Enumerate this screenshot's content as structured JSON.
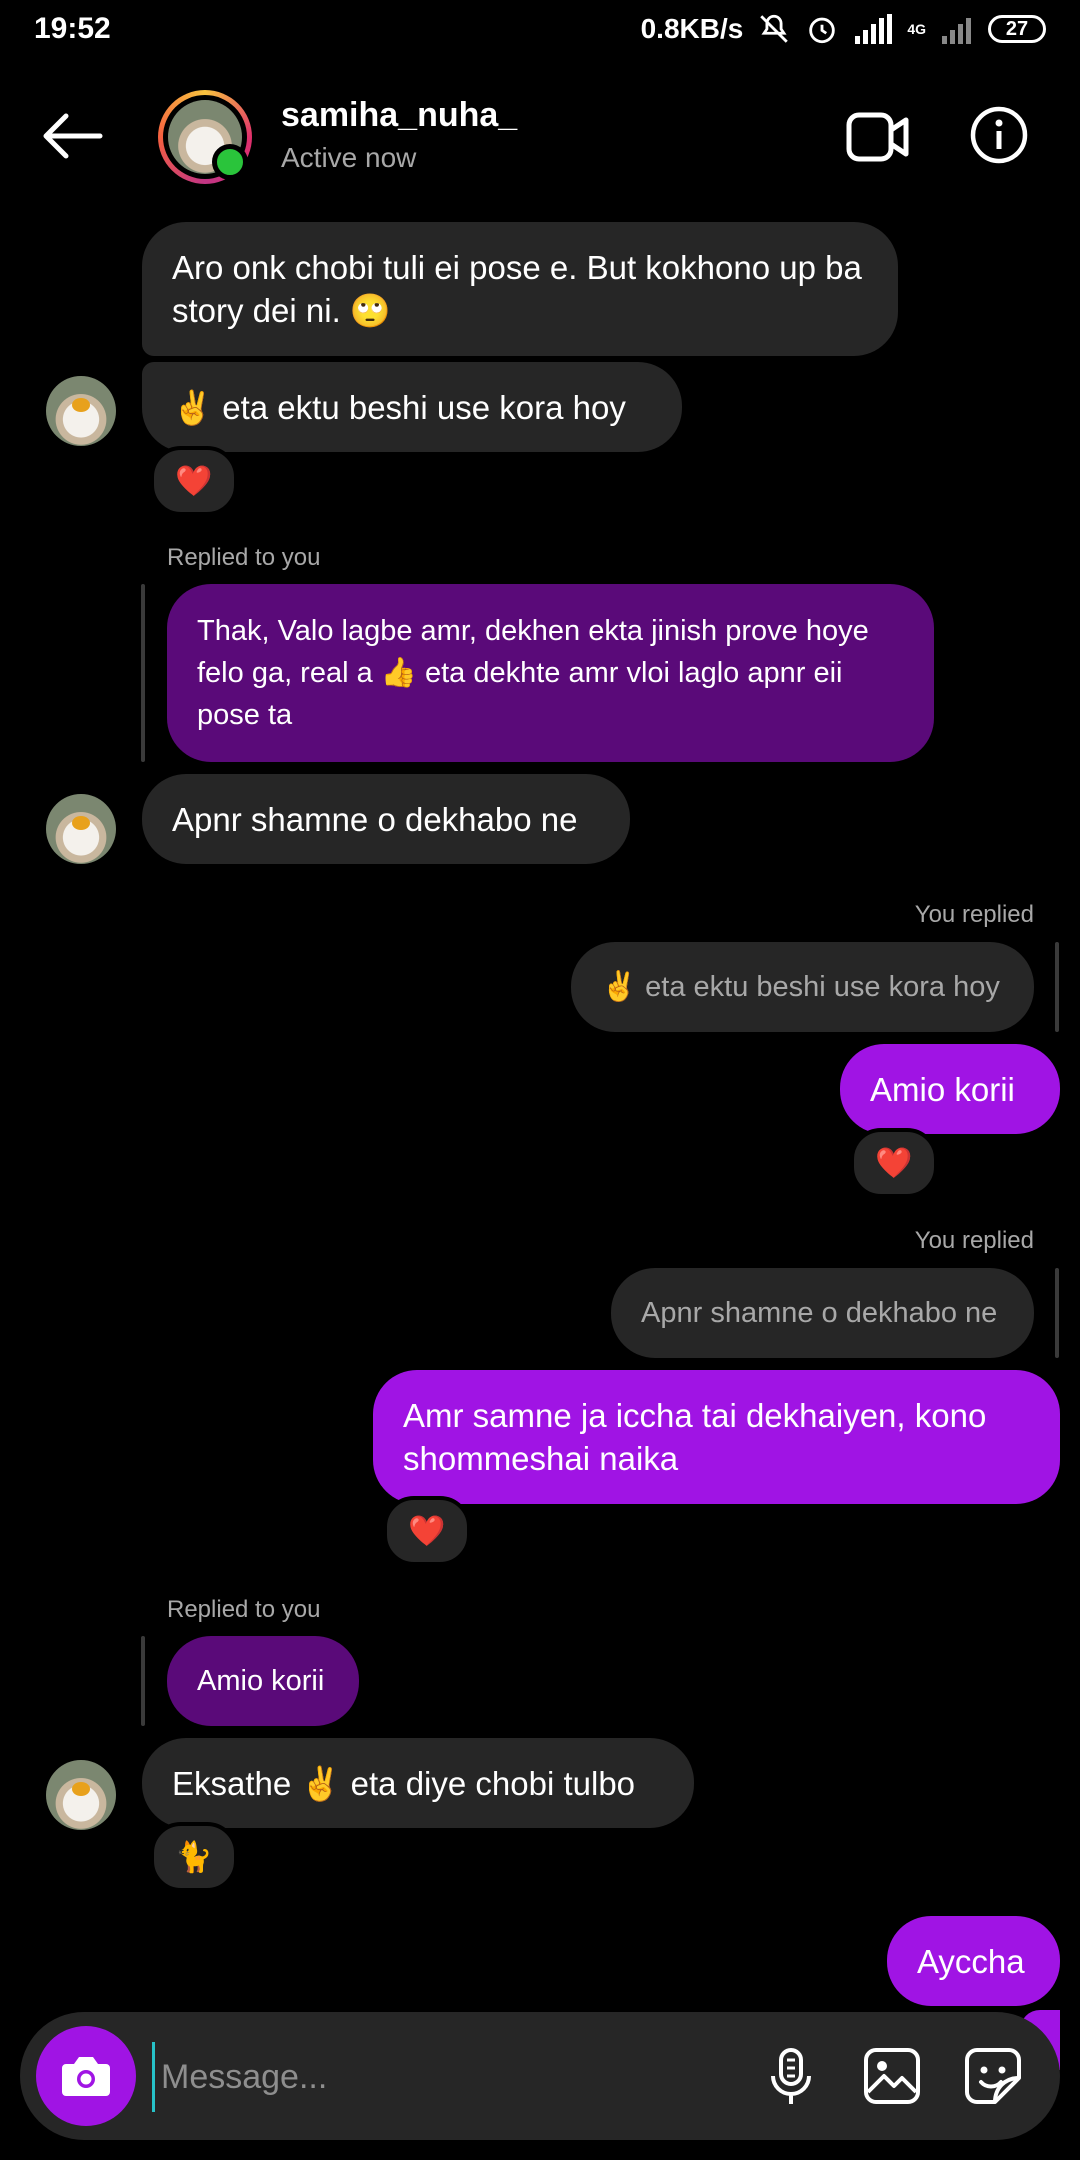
{
  "status_bar": {
    "time": "19:52",
    "net_speed": "0.8KB/s",
    "network": "4G",
    "battery": "27"
  },
  "header": {
    "username": "samiha_nuha_",
    "status": "Active now"
  },
  "messages": {
    "m1": "Aro onk chobi tuli ei pose e. But kokhono up ba story dei ni. 🙄",
    "m2": "✌️ eta ektu beshi use kora hoy",
    "m2_reaction": "❤️",
    "m3_meta": "Replied to you",
    "m3_quote": "Thak, Valo lagbe amr, dekhen ekta jinish prove hoye felo ga, real a 👍 eta dekhte amr vloi laglo apnr eii pose ta",
    "m3": "Apnr shamne o dekhabo ne",
    "m4_meta": "You replied",
    "m4_quote": "✌️ eta ektu beshi use kora hoy",
    "m4": "Amio korii",
    "m4_reaction": "❤️",
    "m5_meta": "You replied",
    "m5_quote": "Apnr shamne o dekhabo ne",
    "m5": "Amr samne ja iccha tai dekhaiyen, kono shommeshai naika",
    "m5_reaction": "❤️",
    "m6_meta": "Replied to you",
    "m6_quote": "Amio korii",
    "m6": "Eksathe ✌️ eta diye chobi tulbo",
    "m6_reaction": "🐈",
    "m7": "Ayccha"
  },
  "composer": {
    "placeholder": "Message..."
  },
  "icons": [
    "back-arrow-icon",
    "video-call-icon",
    "info-icon",
    "camera-icon",
    "microphone-icon",
    "gallery-icon",
    "sticker-icon"
  ],
  "colors": {
    "accent": "#a014e4",
    "incoming": "#262626",
    "online": "#2ac43b"
  }
}
